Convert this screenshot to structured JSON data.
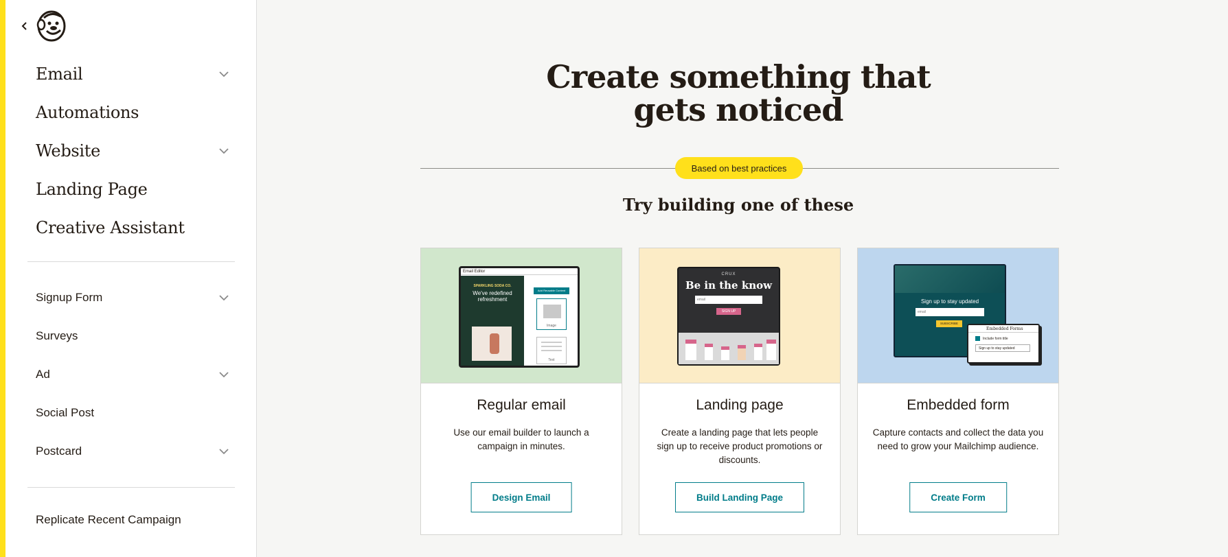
{
  "sidebar": {
    "back_icon": "chevron-left-icon",
    "logo": "mailchimp-freddie-logo",
    "primary_items": [
      {
        "label": "Email",
        "has_chevron": true
      },
      {
        "label": "Automations",
        "has_chevron": false
      },
      {
        "label": "Website",
        "has_chevron": true
      },
      {
        "label": "Landing Page",
        "has_chevron": false
      },
      {
        "label": "Creative Assistant",
        "has_chevron": false
      }
    ],
    "secondary_items": [
      {
        "label": "Signup Form",
        "has_chevron": true
      },
      {
        "label": "Surveys",
        "has_chevron": false
      },
      {
        "label": "Ad",
        "has_chevron": true
      },
      {
        "label": "Social Post",
        "has_chevron": false
      },
      {
        "label": "Postcard",
        "has_chevron": true
      }
    ],
    "replicate_label": "Replicate Recent Campaign"
  },
  "main": {
    "headline_line1": "Create something that",
    "headline_line2": "gets noticed",
    "badge": "Based on best practices",
    "subhead": "Try building one of these",
    "cards": [
      {
        "title": "Regular email",
        "description": "Use our email builder to launch a campaign in minutes.",
        "button": "Design Email",
        "preview": {
          "window_label": "Email Editor",
          "brand": "SPARKLING SODA CO.",
          "headline": "We've redefined refreshment",
          "button": "Add Reusable Content",
          "image_label": "Image",
          "text_label": "Text"
        }
      },
      {
        "title": "Landing page",
        "description": "Create a landing page that lets people sign up to receive product promotions or discounts.",
        "button": "Build Landing Page",
        "preview": {
          "brand": "CRUX",
          "headline": "Be in the know",
          "email_placeholder": "email",
          "cta": "SIGN UP"
        }
      },
      {
        "title": "Embedded form",
        "description": "Capture contacts and collect the data you need to grow your Mailchimp audience.",
        "button": "Create Form",
        "preview": {
          "headline": "Sign up to stay updated",
          "email_placeholder": "email",
          "cta": "SUBSCRIBE",
          "panel_title": "Embedded Forms",
          "checkbox_label": "Include form title",
          "panel_field": "Sign up to stay updated"
        }
      }
    ]
  },
  "colors": {
    "accent": "#ffe01b",
    "teal": "#007c89",
    "card_green": "#d1e7cc",
    "card_yellow": "#fcecc6",
    "card_blue": "#bdd6ee"
  }
}
